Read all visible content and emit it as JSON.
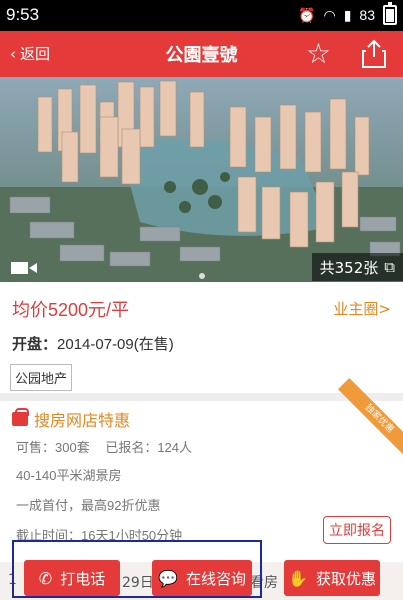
{
  "status_bar": {
    "time": "9:53",
    "battery_level": "83"
  },
  "header": {
    "back_label": "返回",
    "title": "公園壹號"
  },
  "gallery": {
    "photo_count": "共352张"
  },
  "info": {
    "price": "均价5200元/平",
    "owner_circle": "业主圈>",
    "open_label": "开盘：",
    "open_value": "2014-07-09(在售)",
    "developer_tag": "公园地产"
  },
  "promo": {
    "title": "搜房网店特惠",
    "ribbon": "独家优惠",
    "available": "可售：300套",
    "registered": "已报名：124人",
    "feature": "40-140平米湖景房",
    "discount": "一成首付，最高92折优惠",
    "deadline": "截止时间：16天1小时50分钟",
    "apply_label": "立即报名"
  },
  "behind_text": {
    "left": "1",
    "mid": "29日",
    "right": "看房"
  },
  "actions": {
    "call_label": "打电话",
    "consult_label": "在线咨询",
    "offer_label": "获取优惠"
  },
  "colors": {
    "brand_red": "#e53a3a",
    "accent_orange": "#e8861f"
  }
}
